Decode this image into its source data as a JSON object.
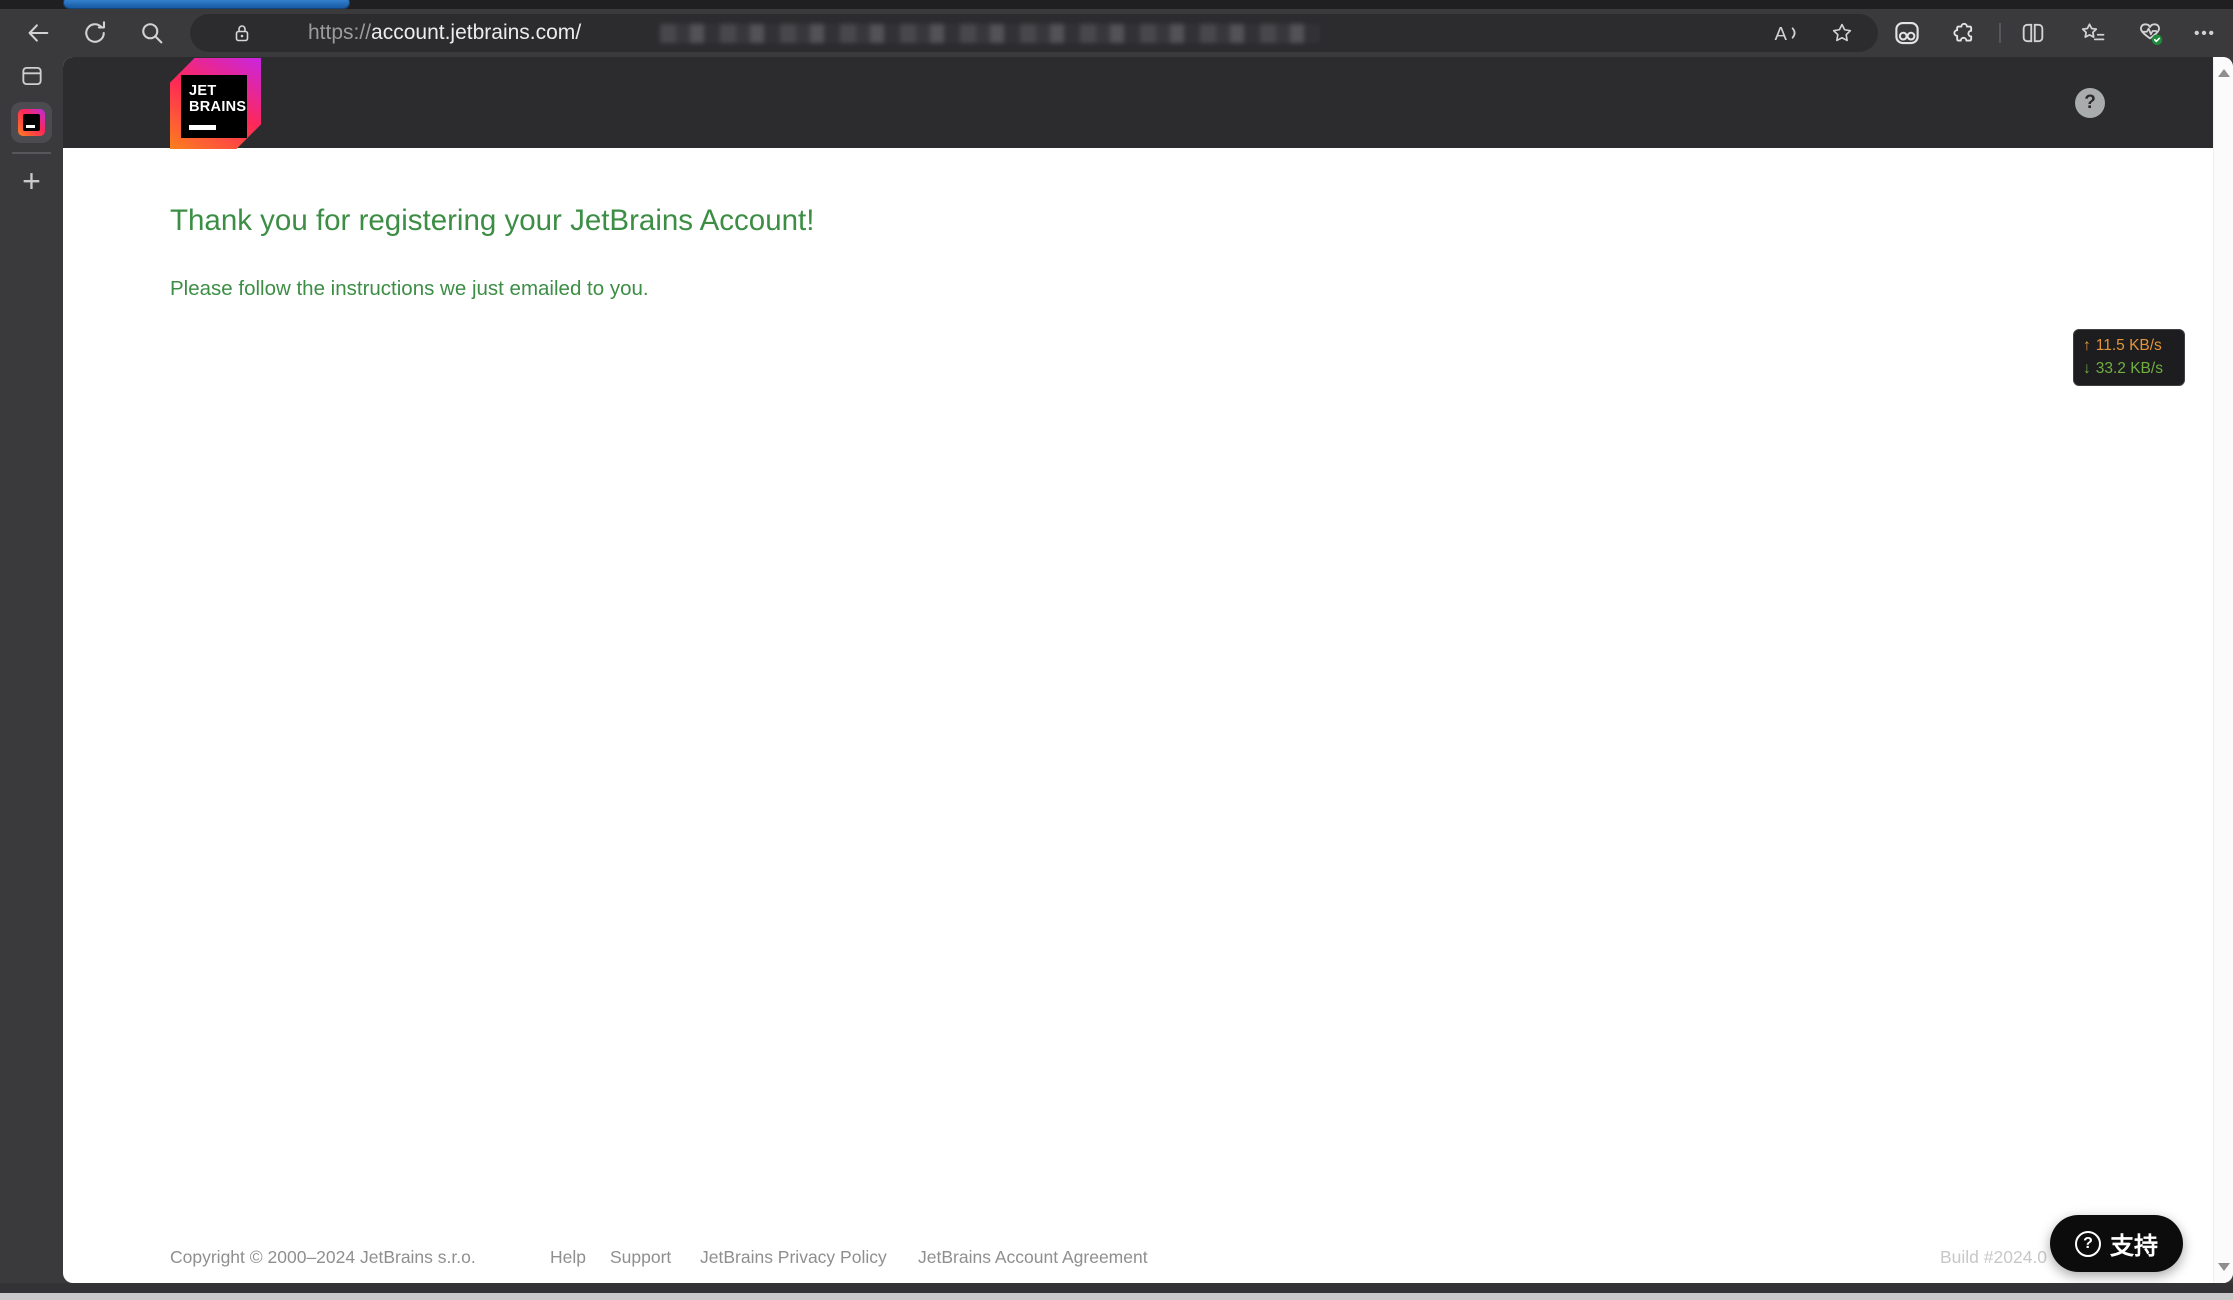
{
  "browser": {
    "address_bar": {
      "scheme": "https://",
      "domain": "account.jetbrains.com",
      "path_visible": "/"
    },
    "more_glyph": "•••",
    "new_tab_glyph": "+"
  },
  "page": {
    "logo": {
      "line1": "JET",
      "line2": "BRAINS"
    },
    "help_glyph": "?",
    "heading": "Thank you for registering your JetBrains Account!",
    "subheading": "Please follow the instructions we just emailed to you.",
    "network_overlay": {
      "up_arrow": "↑",
      "up_value": "11.5 KB/s",
      "down_arrow": "↓",
      "down_value": "33.2 KB/s"
    },
    "footer": {
      "copyright": "Copyright © 2000–2024 JetBrains s.r.o.",
      "links": [
        "Help",
        "Support",
        "JetBrains Privacy Policy",
        "JetBrains Account Agreement"
      ],
      "build": "Build #2024.0"
    },
    "support_button": {
      "icon_glyph": "?",
      "label": "支持"
    }
  },
  "icons": {
    "back": "arrow-left",
    "refresh": "circular-arrow",
    "search": "magnifier",
    "lock": "padlock",
    "read_aloud": "letter-A-with-soundwave",
    "favorite": "star-outline",
    "pinned_extension": "rounded-square-two-dots",
    "extensions": "puzzle-piece",
    "split_screen": "two-panes",
    "favorites_list": "star-with-lines",
    "browser_essentials": "heart-pulse-green-badge",
    "more": "ellipsis",
    "tab_actions": "window-pane",
    "new_tab": "plus",
    "help": "question-mark-circle",
    "scroll_up": "triangle-up",
    "scroll_down": "triangle-down"
  },
  "colors": {
    "accent_green": "#3c8e45",
    "overlay_up_orange": "#e2953a",
    "overlay_down_green": "#6fb03f",
    "logo_gradient": [
      "#c925e2",
      "#fe2857",
      "#fc801d"
    ],
    "chrome_dark": "#3a3a3d",
    "page_header_dark": "#2c2c2e"
  }
}
